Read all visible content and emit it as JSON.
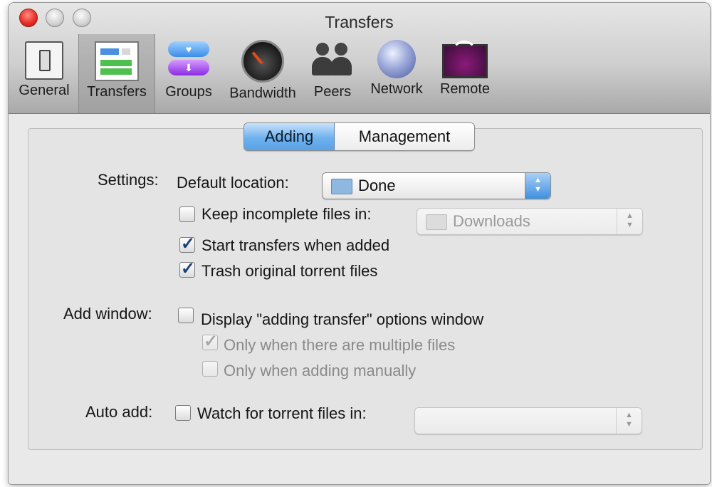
{
  "window": {
    "title": "Transfers"
  },
  "toolbar": {
    "items": [
      {
        "label": "General",
        "icon": "general-switch-icon"
      },
      {
        "label": "Transfers",
        "icon": "transfers-icon"
      },
      {
        "label": "Groups",
        "icon": "groups-icon"
      },
      {
        "label": "Bandwidth",
        "icon": "bandwidth-gauge-icon"
      },
      {
        "label": "Peers",
        "icon": "peers-icon"
      },
      {
        "label": "Network",
        "icon": "network-globe-icon"
      },
      {
        "label": "Remote",
        "icon": "remote-icon"
      }
    ],
    "selected": "Transfers"
  },
  "tabs": {
    "active": "Adding",
    "inactive": "Management"
  },
  "settings": {
    "label": "Settings:",
    "default_location_label": "Default location:",
    "default_location_value": "Done",
    "keep_incomplete_label": "Keep incomplete files in:",
    "keep_incomplete_checked": false,
    "incomplete_folder_value": "Downloads",
    "start_transfers_label": "Start transfers when added",
    "start_transfers_checked": true,
    "trash_original_label": "Trash original torrent files",
    "trash_original_checked": true
  },
  "add_window": {
    "label": "Add window:",
    "display_options_label": "Display \"adding transfer\" options window",
    "display_options_checked": false,
    "only_multiple_label": "Only when there are multiple files",
    "only_multiple_checked": true,
    "only_manual_label": "Only when adding manually",
    "only_manual_checked": false
  },
  "auto_add": {
    "label": "Auto add:",
    "watch_label": "Watch for torrent files in:",
    "watch_checked": false,
    "watch_folder_value": ""
  },
  "colors": {
    "accent_blue": "#5aa2e6",
    "close_red": "#e8302a"
  }
}
